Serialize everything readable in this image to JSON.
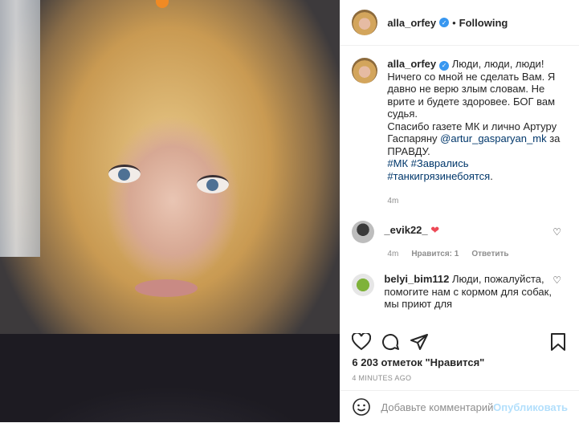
{
  "post": {
    "username": "alla_orfey",
    "follow_status": "Following",
    "separator": "•",
    "caption_user": "alla_orfey",
    "caption_lines": [
      "Люди, люди, люди!",
      "Ничего со мной не сделать Вам. Я",
      "давно не верю злым словам. Не",
      "врите и будете здоровее. БОГ вам",
      "судья.",
      "Спасибо газете МК и лично Артуру",
      "Гаспаряну"
    ],
    "caption_mention": "@artur_gasparyan_mk",
    "caption_after_mention": "за",
    "caption_last": "ПРАВДУ.",
    "hashtag1": "#МК",
    "hashtag2": "#Заврались",
    "hashtag3": "#танкигрязинебоятся",
    "hashtag_end": ".",
    "caption_time": "4m"
  },
  "comments": [
    {
      "user": "_evik22_",
      "text": "❤",
      "time": "4m",
      "likes": "Нравится: 1",
      "reply": "Ответить"
    },
    {
      "user": "belyi_bim112",
      "text": "Люди, пожалуйста, помогите нам с кормом для собак, мы приют для"
    }
  ],
  "likes_text": "6 203 отметок \"Нравится\"",
  "timestamp": "4 MINUTES AGO",
  "add_comment": {
    "placeholder": "Добавьте комментарий...",
    "publish": "Опубликовать"
  },
  "icons": [
    "verified-badge",
    "heart-icon",
    "comment-icon",
    "share-icon",
    "bookmark-icon",
    "emoji-icon"
  ],
  "colors": {
    "link": "#00376b",
    "verified": "#3897f0",
    "heart": "#ed4956",
    "publish": "#b2dffc"
  }
}
